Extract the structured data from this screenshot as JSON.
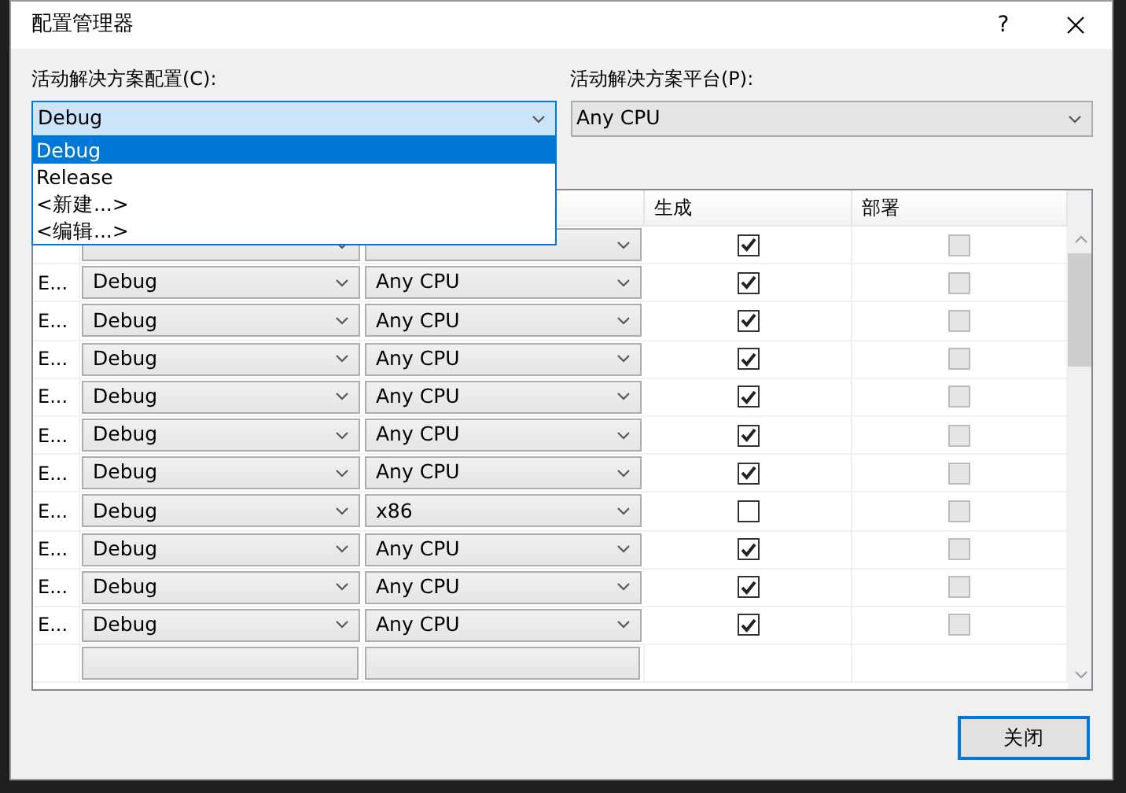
{
  "window": {
    "title": "配置管理器",
    "help": "?"
  },
  "active_config": {
    "label": "活动解决方案配置(C):",
    "value": "Debug",
    "expanded": true,
    "options": [
      {
        "label": "Debug",
        "selected": true
      },
      {
        "label": "Release",
        "selected": false
      },
      {
        "label": "<新建...>",
        "selected": false
      },
      {
        "label": "<编辑...>",
        "selected": false
      }
    ]
  },
  "active_platform": {
    "label": "活动解决方案平台(P):",
    "value": "Any CPU"
  },
  "table": {
    "columns": [
      "生成",
      "部署"
    ],
    "rows": [
      {
        "build": true,
        "deploy": false
      },
      {
        "project": "E...",
        "config": "Debug",
        "platform": "Any CPU",
        "build": true,
        "deploy": false
      },
      {
        "project": "E...",
        "config": "Debug",
        "platform": "Any CPU",
        "build": true,
        "deploy": false
      },
      {
        "project": "E...",
        "config": "Debug",
        "platform": "Any CPU",
        "build": true,
        "deploy": false
      },
      {
        "project": "E...",
        "config": "Debug",
        "platform": "Any CPU",
        "build": true,
        "deploy": false
      },
      {
        "project": "E...",
        "config": "Debug",
        "platform": "Any CPU",
        "build": true,
        "deploy": false
      },
      {
        "project": "E...",
        "config": "Debug",
        "platform": "Any CPU",
        "build": true,
        "deploy": false
      },
      {
        "project": "E...",
        "config": "Debug",
        "platform": "x86",
        "build": false,
        "deploy": false
      },
      {
        "project": "E...",
        "config": "Debug",
        "platform": "Any CPU",
        "build": true,
        "deploy": false
      },
      {
        "project": "E...",
        "config": "Debug",
        "platform": "Any CPU",
        "build": true,
        "deploy": false
      },
      {
        "project": "E...",
        "config": "Debug",
        "platform": "Any CPU",
        "build": true,
        "deploy": false
      }
    ]
  },
  "buttons": [
    "关闭"
  ]
}
